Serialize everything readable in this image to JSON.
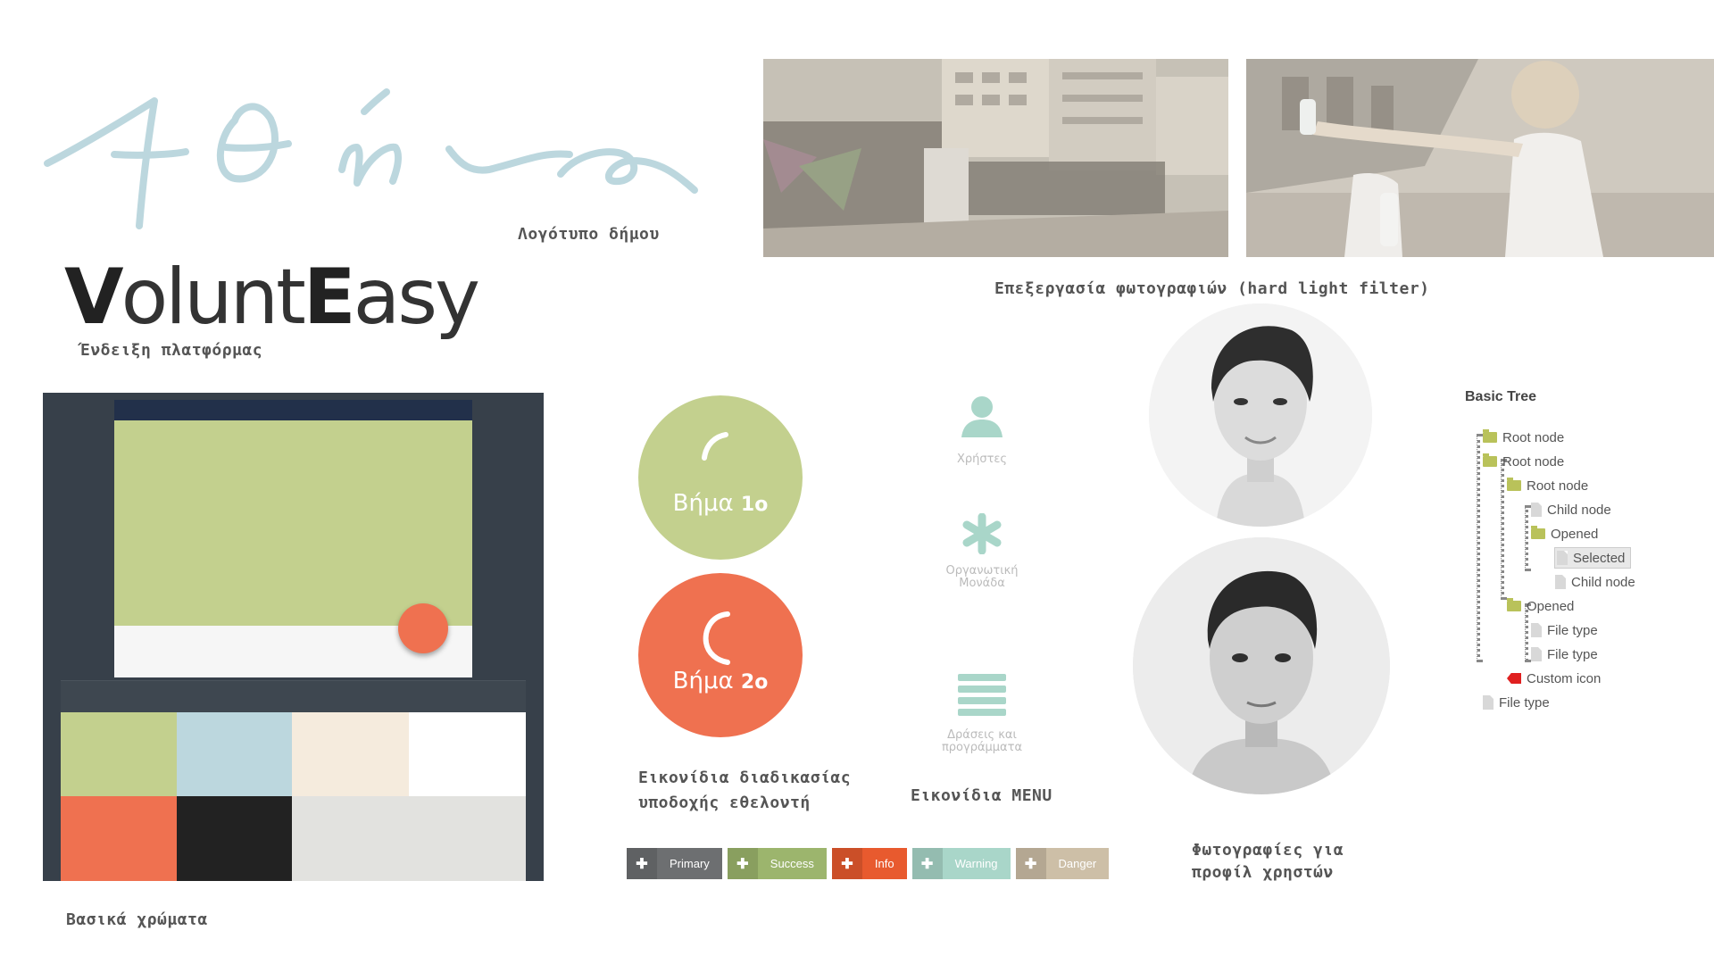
{
  "logo": {
    "script_text": "Α Θήνα",
    "caption": "Λογότυπο δήμου"
  },
  "brand": {
    "first_cap": "V",
    "first_rest": "olunt",
    "second_cap": "E",
    "second_rest": "asy",
    "caption": "Ένδειξη πλατφόρμας"
  },
  "photos": {
    "caption": "Επεξεργασία φωτογραφιών (hard light filter)"
  },
  "palette": {
    "caption": "Βασικά χρώματα",
    "colors": [
      "#c3d08e",
      "#bcd7de",
      "#f5ebdd",
      "#ffffff",
      "#ef7150",
      "#222222",
      "#e2e2df",
      "#e2e2df"
    ]
  },
  "steps": {
    "step1_label": "Βήμα",
    "step1_num": "1ο",
    "step2_label": "Βήμα",
    "step2_num": "2ο",
    "caption_line1": "Εικονίδια διαδικασίας",
    "caption_line2": "υποδοχής εθελοντή"
  },
  "menu": {
    "users_label": "Χρήστες",
    "org_label_line1": "Οργανωτική",
    "org_label_line2": "Μονάδα",
    "actions_label_line1": "Δράσεις και",
    "actions_label_line2": "προγράμματα",
    "caption": "Εικονίδια MENU"
  },
  "profiles": {
    "caption_line1": "Φωτογραφίες για",
    "caption_line2": "προφίλ χρηστών"
  },
  "buttons": [
    {
      "label": "Primary",
      "color": "#6d6f71"
    },
    {
      "label": "Success",
      "color": "#9cb56d"
    },
    {
      "label": "Info",
      "color": "#e85a2e"
    },
    {
      "label": "Warning",
      "color": "#a9d6c9"
    },
    {
      "label": "Danger",
      "color": "#cdbfa7"
    }
  ],
  "tree": {
    "title": "Basic Tree",
    "nodes": [
      "Root node",
      "Root node",
      "Root node",
      "Child node",
      "Opened",
      "Selected",
      "Child node",
      "Opened",
      "File type",
      "File type",
      "Custom icon",
      "File type"
    ]
  }
}
